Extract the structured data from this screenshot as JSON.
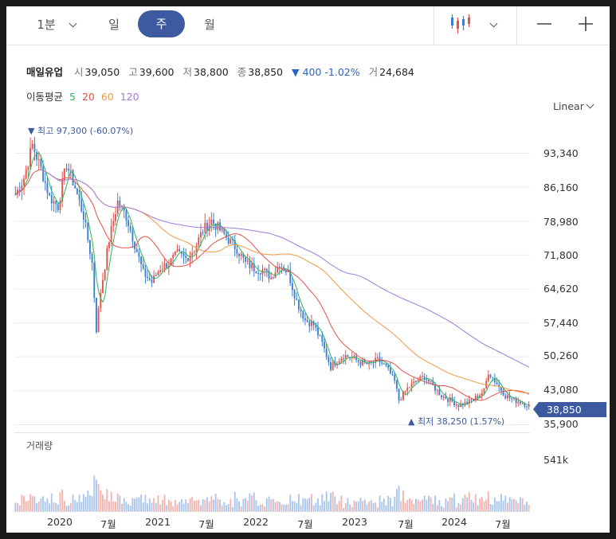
{
  "toolbar": {
    "interval_options": [
      "1분",
      "일",
      "주",
      "월"
    ],
    "selected_interval": "주",
    "chart_style_icon": "candlestick-icon",
    "zoom_out_icon": "minus-icon",
    "zoom_in_icon": "plus-icon"
  },
  "quote": {
    "name": "매일유업",
    "open_label": "시",
    "open": "39,050",
    "high_label": "고",
    "high": "39,600",
    "low_label": "저",
    "low": "38,800",
    "close_label": "종",
    "close": "38,850",
    "change": "▼ 400 -1.02%",
    "volume_label": "거",
    "volume": "24,684"
  },
  "moving_average": {
    "label": "이동평균",
    "periods": [
      {
        "period": "5",
        "color": "#2db35d"
      },
      {
        "period": "20",
        "color": "#e2534b"
      },
      {
        "period": "60",
        "color": "#f09a45"
      },
      {
        "period": "120",
        "color": "#a17ad8"
      }
    ]
  },
  "scale_mode": "Linear",
  "colors": {
    "up": "#e2534b",
    "down": "#3d7ed0",
    "accent": "#3d5aa1"
  },
  "annotations": {
    "high": "▼ 최고 97,300 (-60.07%)",
    "low": "▲ 최저 38,250 (1.57%)"
  },
  "current_price_tag": "38,850",
  "volume_title": "거래량",
  "chart_data": {
    "type": "candlestick",
    "y_tick_labels": [
      "93,340",
      "86,160",
      "78,980",
      "71,800",
      "64,620",
      "57,440",
      "50,260",
      "43,080",
      "35,900"
    ],
    "y_ticks": [
      93340,
      86160,
      78980,
      71800,
      64620,
      57440,
      50260,
      43080,
      35900
    ],
    "ylim": [
      35900,
      93340
    ],
    "volume_tick_label": "541k",
    "volume_tick": 541000,
    "x_tick_labels": [
      "2020",
      "7월",
      "2021",
      "7월",
      "2022",
      "7월",
      "2023",
      "7월",
      "2024",
      "7월"
    ],
    "price_path": [
      [
        0,
        84500
      ],
      [
        4,
        88000
      ],
      [
        8,
        95000
      ],
      [
        12,
        90000
      ],
      [
        16,
        84000
      ],
      [
        20,
        82000
      ],
      [
        24,
        91000
      ],
      [
        28,
        86000
      ],
      [
        32,
        80000
      ],
      [
        36,
        70000
      ],
      [
        38,
        56000
      ],
      [
        40,
        64000
      ],
      [
        44,
        75000
      ],
      [
        48,
        83000
      ],
      [
        52,
        80000
      ],
      [
        56,
        74000
      ],
      [
        60,
        68000
      ],
      [
        64,
        66000
      ],
      [
        68,
        69000
      ],
      [
        72,
        70000
      ],
      [
        76,
        72000
      ],
      [
        80,
        71000
      ],
      [
        84,
        73000
      ],
      [
        88,
        77000
      ],
      [
        92,
        79000
      ],
      [
        96,
        77000
      ],
      [
        100,
        75000
      ],
      [
        104,
        73000
      ],
      [
        108,
        70000
      ],
      [
        112,
        69000
      ],
      [
        116,
        68500
      ],
      [
        120,
        67000
      ],
      [
        124,
        70000
      ],
      [
        128,
        68000
      ],
      [
        132,
        62000
      ],
      [
        136,
        58000
      ],
      [
        140,
        57000
      ],
      [
        144,
        53000
      ],
      [
        148,
        48000
      ],
      [
        150,
        49000
      ],
      [
        154,
        50500
      ],
      [
        158,
        50000
      ],
      [
        162,
        49000
      ],
      [
        166,
        48500
      ],
      [
        170,
        49500
      ],
      [
        174,
        48000
      ],
      [
        178,
        45000
      ],
      [
        180,
        41000
      ],
      [
        184,
        43500
      ],
      [
        188,
        45000
      ],
      [
        192,
        46000
      ],
      [
        196,
        44000
      ],
      [
        200,
        42000
      ],
      [
        204,
        41000
      ],
      [
        208,
        40000
      ],
      [
        212,
        40500
      ],
      [
        216,
        41500
      ],
      [
        220,
        43000
      ],
      [
        222,
        47000
      ],
      [
        226,
        44500
      ],
      [
        230,
        42000
      ],
      [
        234,
        41000
      ],
      [
        238,
        40500
      ],
      [
        241,
        39800
      ]
    ]
  }
}
